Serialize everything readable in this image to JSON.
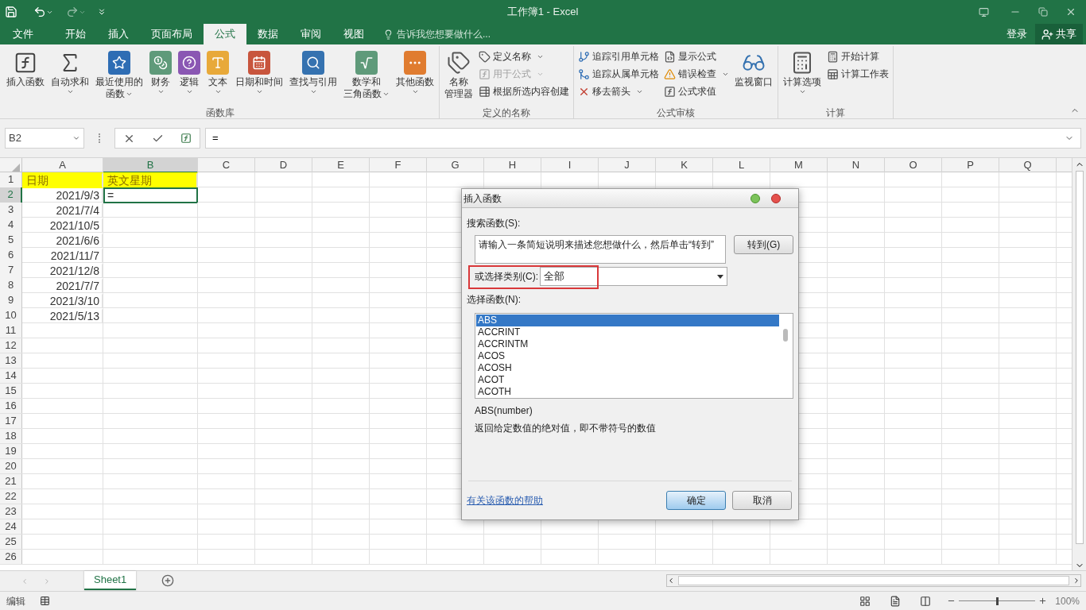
{
  "window": {
    "title": "工作簿1 - Excel"
  },
  "tabs": [
    {
      "label": "文件",
      "selected": false
    },
    {
      "label": "开始",
      "selected": false
    },
    {
      "label": "插入",
      "selected": false
    },
    {
      "label": "页面布局",
      "selected": false
    },
    {
      "label": "公式",
      "selected": true
    },
    {
      "label": "数据",
      "selected": false
    },
    {
      "label": "审阅",
      "selected": false
    },
    {
      "label": "视图",
      "selected": false
    }
  ],
  "tell_me": {
    "placeholder": "告诉我您想要做什么..."
  },
  "account": {
    "sign_in": "登录",
    "share": "共享"
  },
  "ribbon": {
    "groups": [
      {
        "label": "函数库",
        "items": [
          {
            "kind": "large",
            "lines": [
              "插入函数"
            ],
            "dropdown": false,
            "disabled": false
          },
          {
            "kind": "large",
            "lines": [
              "自动求和"
            ],
            "dropdown": true,
            "disabled": false
          },
          {
            "kind": "large",
            "lines": [
              "最近使用的",
              "函数"
            ],
            "dropdown": true,
            "disabled": false
          },
          {
            "kind": "large",
            "lines": [
              "财务"
            ],
            "dropdown": true,
            "disabled": false
          },
          {
            "kind": "large",
            "lines": [
              "逻辑"
            ],
            "dropdown": true,
            "disabled": false
          },
          {
            "kind": "large",
            "lines": [
              "文本"
            ],
            "dropdown": true,
            "disabled": false
          },
          {
            "kind": "large",
            "lines": [
              "日期和时间"
            ],
            "dropdown": true,
            "disabled": false
          },
          {
            "kind": "large",
            "lines": [
              "查找与引用"
            ],
            "dropdown": true,
            "disabled": false
          },
          {
            "kind": "large",
            "lines": [
              "数学和",
              "三角函数"
            ],
            "dropdown": true,
            "disabled": false
          },
          {
            "kind": "large",
            "lines": [
              "其他函数"
            ],
            "dropdown": true,
            "disabled": false
          }
        ]
      },
      {
        "label": "定义的名称",
        "items": [
          {
            "kind": "large",
            "lines": [
              "名称",
              "管理器"
            ],
            "dropdown": false,
            "disabled": false
          },
          {
            "kind": "small",
            "lines": [
              "定义名称"
            ],
            "dropdown": true,
            "disabled": false
          },
          {
            "kind": "small",
            "lines": [
              "用于公式"
            ],
            "dropdown": true,
            "disabled": true
          },
          {
            "kind": "small",
            "lines": [
              "根据所选内容创建"
            ],
            "dropdown": false,
            "disabled": false
          }
        ]
      },
      {
        "label": "公式审核",
        "items": [
          {
            "kind": "small",
            "lines": [
              "追踪引用单元格"
            ],
            "dropdown": false,
            "disabled": false
          },
          {
            "kind": "small",
            "lines": [
              "追踪从属单元格"
            ],
            "dropdown": false,
            "disabled": false
          },
          {
            "kind": "small",
            "lines": [
              "移去箭头"
            ],
            "dropdown": true,
            "disabled": false
          },
          {
            "kind": "small",
            "lines": [
              "显示公式"
            ],
            "dropdown": false,
            "disabled": false
          },
          {
            "kind": "small",
            "lines": [
              "错误检查"
            ],
            "dropdown": true,
            "disabled": false
          },
          {
            "kind": "small",
            "lines": [
              "公式求值"
            ],
            "dropdown": false,
            "disabled": false
          },
          {
            "kind": "large",
            "lines": [
              "监视窗口"
            ],
            "dropdown": false,
            "disabled": false
          }
        ]
      },
      {
        "label": "计算",
        "items": [
          {
            "kind": "large",
            "lines": [
              "计算选项"
            ],
            "dropdown": true,
            "disabled": false
          },
          {
            "kind": "small",
            "lines": [
              "开始计算"
            ],
            "dropdown": false,
            "disabled": false
          },
          {
            "kind": "small",
            "lines": [
              "计算工作表"
            ],
            "dropdown": false,
            "disabled": false
          }
        ]
      }
    ]
  },
  "formula_bar": {
    "name_box": "B2",
    "formula": "="
  },
  "sheet": {
    "columns": [
      "A",
      "B",
      "C",
      "D",
      "E",
      "F",
      "G",
      "H",
      "I",
      "J",
      "K",
      "L",
      "M",
      "N",
      "O",
      "P",
      "Q"
    ],
    "rows": [
      {
        "number": "1",
        "highlighted": true,
        "cells": [
          {
            "text": "日期",
            "selected": false
          },
          {
            "text": "英文星期",
            "selected": false
          }
        ]
      },
      {
        "number": "2",
        "highlighted": false,
        "cells": [
          {
            "text": "2021/9/3",
            "selected": false
          },
          {
            "text": "=",
            "selected": true
          }
        ]
      },
      {
        "number": "3",
        "highlighted": false,
        "cells": [
          {
            "text": "2021/7/4",
            "selected": false
          }
        ]
      },
      {
        "number": "4",
        "highlighted": false,
        "cells": [
          {
            "text": "2021/10/5",
            "selected": false
          }
        ]
      },
      {
        "number": "5",
        "highlighted": false,
        "cells": [
          {
            "text": "2021/6/6",
            "selected": false
          }
        ]
      },
      {
        "number": "6",
        "highlighted": false,
        "cells": [
          {
            "text": "2021/11/7",
            "selected": false
          }
        ]
      },
      {
        "number": "7",
        "highlighted": false,
        "cells": [
          {
            "text": "2021/12/8",
            "selected": false
          }
        ]
      },
      {
        "number": "8",
        "highlighted": false,
        "cells": [
          {
            "text": "2021/7/7",
            "selected": false
          }
        ]
      },
      {
        "number": "9",
        "highlighted": false,
        "cells": [
          {
            "text": "2021/3/10",
            "selected": false
          }
        ]
      },
      {
        "number": "10",
        "highlighted": false,
        "cells": [
          {
            "text": "2021/5/13",
            "selected": false
          }
        ]
      },
      {
        "number": "11"
      },
      {
        "number": "12"
      },
      {
        "number": "13"
      },
      {
        "number": "14"
      },
      {
        "number": "15"
      },
      {
        "number": "16"
      },
      {
        "number": "17"
      },
      {
        "number": "18"
      },
      {
        "number": "19"
      },
      {
        "number": "20"
      },
      {
        "number": "21"
      },
      {
        "number": "22"
      },
      {
        "number": "23"
      },
      {
        "number": "24"
      },
      {
        "number": "25"
      },
      {
        "number": "26"
      }
    ]
  },
  "dialog": {
    "title": "插入函数",
    "search_label": "搜索函数(S):",
    "search_field": {
      "value": "请输入一条简短说明来描述您想做什么，然后单击“转到”"
    },
    "go_button": "转到(G)",
    "category_label": "或选择类别(C):",
    "category_value": "全部",
    "function_list_label": "选择函数(N):",
    "functions": [
      {
        "name": "ABS",
        "selected": true
      },
      {
        "name": "ACCRINT",
        "selected": false
      },
      {
        "name": "ACCRINTM",
        "selected": false
      },
      {
        "name": "ACOS",
        "selected": false
      },
      {
        "name": "ACOSH",
        "selected": false
      },
      {
        "name": "ACOT",
        "selected": false
      },
      {
        "name": "ACOTH",
        "selected": false
      }
    ],
    "signature": "ABS(number)",
    "description": "返回给定数值的绝对值，即不带符号的数值",
    "help_link": "有关该函数的帮助",
    "ok_button": "确定",
    "cancel_button": "取消"
  },
  "sheet_tabs": [
    {
      "label": "Sheet1",
      "selected": true
    }
  ],
  "status_bar": {
    "mode": "编辑",
    "zoom": {
      "level": 0.5,
      "reading": "100%"
    }
  }
}
